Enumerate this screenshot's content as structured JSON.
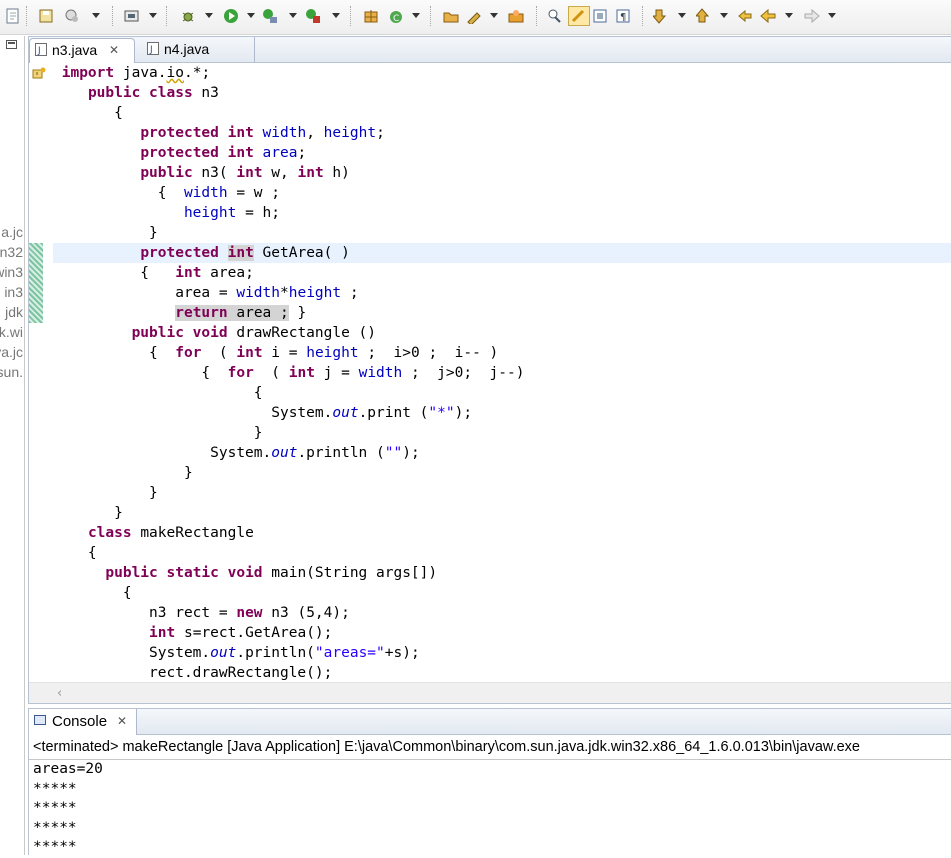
{
  "toolbar": {
    "icons": [
      "new-icon",
      "save-all-icon",
      "print-icon",
      "open-type-icon",
      "debug-icon",
      "run-icon",
      "coverage-icon",
      "external-tools-icon",
      "new-java-project-icon",
      "new-package-icon",
      "new-class-icon",
      "open-task-icon",
      "search-icon",
      "open-folder-icon",
      "toggle-breakpoint-icon",
      "mark-occurrences-icon",
      "block-selection-icon",
      "show-whitespace-icon",
      "next-annotation-icon",
      "previous-annotation-icon",
      "last-edit-icon",
      "back-icon",
      "forward-icon"
    ]
  },
  "package_explorer": {
    "items": [
      "a.jc",
      "n32",
      "win3",
      "in3",
      "jdk",
      "k.wi",
      "va.jc",
      "sun."
    ]
  },
  "editor": {
    "tabs": [
      {
        "label": "n3.java",
        "active": true
      },
      {
        "label": "n4.java",
        "active": false
      }
    ],
    "close_glyph": "✕",
    "lines": [
      {
        "t": [
          {
            "k": "kw",
            "s": "import"
          },
          {
            "s": " java."
          },
          {
            "k": "sq",
            "s": "io"
          },
          {
            "s": ".*;"
          }
        ]
      },
      {
        "t": [
          {
            "s": "   "
          },
          {
            "k": "kw",
            "s": "public class"
          },
          {
            "s": " n3"
          }
        ]
      },
      {
        "t": [
          {
            "s": "      {"
          }
        ]
      },
      {
        "t": [
          {
            "s": "         "
          },
          {
            "k": "kw",
            "s": "protected int"
          },
          {
            "s": " "
          },
          {
            "k": "fd",
            "s": "width"
          },
          {
            "s": ", "
          },
          {
            "k": "fd",
            "s": "height"
          },
          {
            "s": ";"
          }
        ]
      },
      {
        "t": [
          {
            "s": "         "
          },
          {
            "k": "kw",
            "s": "protected int"
          },
          {
            "s": " "
          },
          {
            "k": "fd",
            "s": "area"
          },
          {
            "s": ";"
          }
        ]
      },
      {
        "t": [
          {
            "s": "         "
          },
          {
            "k": "kw",
            "s": "public"
          },
          {
            "s": " n3( "
          },
          {
            "k": "kw",
            "s": "int"
          },
          {
            "s": " w, "
          },
          {
            "k": "kw",
            "s": "int"
          },
          {
            "s": " h)"
          }
        ]
      },
      {
        "t": [
          {
            "s": "           {  "
          },
          {
            "k": "fd",
            "s": "width"
          },
          {
            "s": " = w ;"
          }
        ]
      },
      {
        "t": [
          {
            "s": "              "
          },
          {
            "k": "fd",
            "s": "height"
          },
          {
            "s": " = h;"
          }
        ]
      },
      {
        "t": [
          {
            "s": "          }"
          }
        ]
      },
      {
        "cur": true,
        "t": [
          {
            "s": "         "
          },
          {
            "k": "kw",
            "s": "protected"
          },
          {
            "s": " "
          },
          {
            "k": "kwocc",
            "s": "int"
          },
          {
            "s": " GetArea( )"
          }
        ]
      },
      {
        "t": [
          {
            "s": "         {   "
          },
          {
            "k": "kw",
            "s": "int"
          },
          {
            "s": " area;"
          }
        ]
      },
      {
        "t": [
          {
            "s": "             area = "
          },
          {
            "k": "fd",
            "s": "width"
          },
          {
            "s": "*"
          },
          {
            "k": "fd",
            "s": "height"
          },
          {
            "s": " ;"
          }
        ]
      },
      {
        "t": [
          {
            "s": "             "
          },
          {
            "k": "kwocc",
            "s": "return"
          },
          {
            "k": "occ",
            "s": " area ;"
          },
          {
            "s": " }"
          }
        ]
      },
      {
        "t": [
          {
            "s": "        "
          },
          {
            "k": "kw",
            "s": "public void"
          },
          {
            "s": " drawRectangle ()"
          }
        ]
      },
      {
        "t": [
          {
            "s": "          {  "
          },
          {
            "k": "kw",
            "s": "for"
          },
          {
            "s": "  ( "
          },
          {
            "k": "kw",
            "s": "int"
          },
          {
            "s": " i = "
          },
          {
            "k": "fd",
            "s": "height"
          },
          {
            "s": " ;  i>0 ;  i-- )"
          }
        ]
      },
      {
        "t": [
          {
            "s": "                {  "
          },
          {
            "k": "kw",
            "s": "for"
          },
          {
            "s": "  ( "
          },
          {
            "k": "kw",
            "s": "int"
          },
          {
            "s": " j = "
          },
          {
            "k": "fd",
            "s": "width"
          },
          {
            "s": " ;  j>0;  j--)"
          }
        ]
      },
      {
        "t": [
          {
            "s": "                      {"
          }
        ]
      },
      {
        "t": [
          {
            "s": "                        System."
          },
          {
            "k": "it",
            "s": "out"
          },
          {
            "s": ".print ("
          },
          {
            "k": "st",
            "s": "\"*\""
          },
          {
            "s": ");"
          }
        ]
      },
      {
        "t": [
          {
            "s": "                      }"
          }
        ]
      },
      {
        "t": [
          {
            "s": "                 System."
          },
          {
            "k": "it",
            "s": "out"
          },
          {
            "s": ".println ("
          },
          {
            "k": "st",
            "s": "\"\""
          },
          {
            "s": ");"
          }
        ]
      },
      {
        "t": [
          {
            "s": "              }"
          }
        ]
      },
      {
        "t": [
          {
            "s": "          }"
          }
        ]
      },
      {
        "t": [
          {
            "s": "      }"
          }
        ]
      },
      {
        "t": [
          {
            "s": "   "
          },
          {
            "k": "kw",
            "s": "class"
          },
          {
            "s": " makeRectangle"
          }
        ]
      },
      {
        "t": [
          {
            "s": "   {"
          }
        ]
      },
      {
        "t": [
          {
            "s": "     "
          },
          {
            "k": "kw",
            "s": "public static void"
          },
          {
            "s": " main(String args[])"
          }
        ]
      },
      {
        "t": [
          {
            "s": "       {"
          }
        ]
      },
      {
        "t": [
          {
            "s": "          n3 rect = "
          },
          {
            "k": "kw",
            "s": "new"
          },
          {
            "s": " n3 (5,4);"
          }
        ]
      },
      {
        "t": [
          {
            "s": "          "
          },
          {
            "k": "kw",
            "s": "int"
          },
          {
            "s": " s=rect.GetArea();"
          }
        ]
      },
      {
        "t": [
          {
            "s": "          System."
          },
          {
            "k": "it",
            "s": "out"
          },
          {
            "s": ".println("
          },
          {
            "k": "st",
            "s": "\"areas=\""
          },
          {
            "s": "+s);"
          }
        ]
      },
      {
        "t": [
          {
            "s": "          rect.drawRectangle();"
          }
        ]
      }
    ],
    "scroll_left_glyph": "‹"
  },
  "console": {
    "tab_label": "Console",
    "close_glyph": "✕",
    "description": "<terminated> makeRectangle [Java Application] E:\\java\\Common\\binary\\com.sun.java.jdk.win32.x86_64_1.6.0.013\\bin\\javaw.exe",
    "output": [
      "areas=20",
      "*****",
      "*****",
      "*****",
      "*****"
    ]
  },
  "colors": {
    "keyword": "#7f0055",
    "field": "#0000c0",
    "string": "#2a00ff",
    "current_line": "#e8f2fe",
    "occurrence": "#d4d4d4"
  }
}
